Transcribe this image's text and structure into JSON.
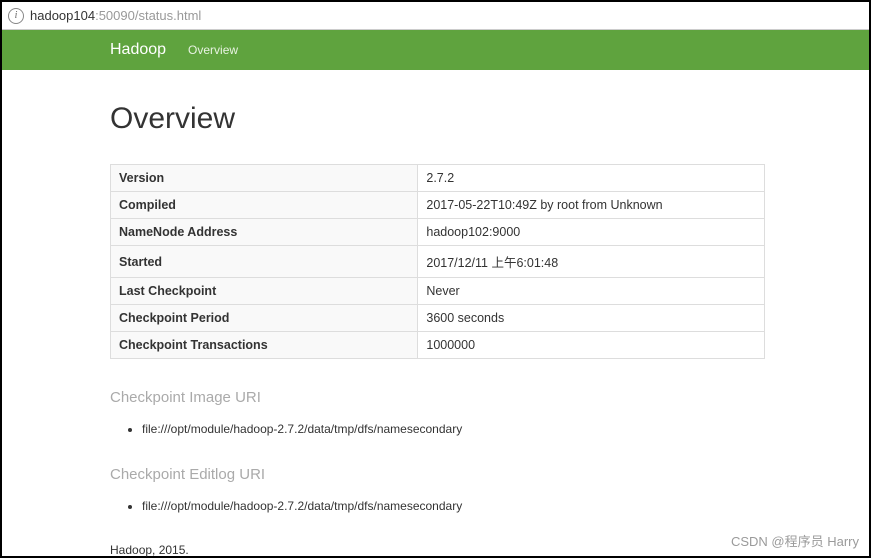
{
  "urlbar": {
    "host": "hadoop104",
    "rest": ":50090/status.html"
  },
  "navbar": {
    "brand": "Hadoop",
    "item_overview": "Overview"
  },
  "page": {
    "title": "Overview"
  },
  "summary": {
    "rows": [
      {
        "label": "Version",
        "value": "2.7.2"
      },
      {
        "label": "Compiled",
        "value": "2017-05-22T10:49Z by root from Unknown"
      },
      {
        "label": "NameNode Address",
        "value": "hadoop102:9000"
      },
      {
        "label": "Started",
        "value": "2017/12/11 上午6:01:48"
      },
      {
        "label": "Last Checkpoint",
        "value": "Never"
      },
      {
        "label": "Checkpoint Period",
        "value": "3600 seconds"
      },
      {
        "label": "Checkpoint Transactions",
        "value": "1000000"
      }
    ]
  },
  "sections": {
    "image_uri_title": "Checkpoint Image URI",
    "image_uri_items": [
      "file:///opt/module/hadoop-2.7.2/data/tmp/dfs/namesecondary"
    ],
    "editlog_uri_title": "Checkpoint Editlog URI",
    "editlog_uri_items": [
      "file:///opt/module/hadoop-2.7.2/data/tmp/dfs/namesecondary"
    ]
  },
  "footer": "Hadoop, 2015.",
  "watermark": "CSDN @程序员 Harry"
}
